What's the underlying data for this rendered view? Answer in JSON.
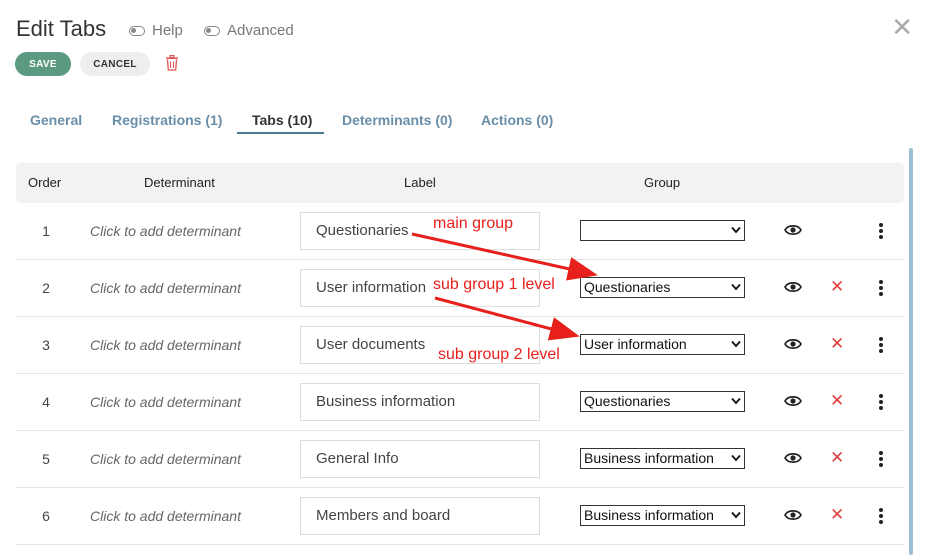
{
  "header": {
    "title": "Edit Tabs",
    "help_label": "Help",
    "advanced_label": "Advanced"
  },
  "toolbar": {
    "save_label": "SAVE",
    "cancel_label": "CANCEL"
  },
  "tabs": [
    {
      "label": "General"
    },
    {
      "label": "Registrations (1)"
    },
    {
      "label": "Tabs (10)"
    },
    {
      "label": "Determinants (0)"
    },
    {
      "label": "Actions (0)"
    }
  ],
  "active_tab": "Tabs (10)",
  "table": {
    "headers": {
      "order": "Order",
      "determinant": "Determinant",
      "label": "Label",
      "group": "Group"
    },
    "rows": [
      {
        "order": "1",
        "determinant": "Click to add determinant",
        "label": "Questionaries",
        "group": ""
      },
      {
        "order": "2",
        "determinant": "Click to add determinant",
        "label": "User information",
        "group": "Questionaries"
      },
      {
        "order": "3",
        "determinant": "Click to add determinant",
        "label": "User documents",
        "group": "User information"
      },
      {
        "order": "4",
        "determinant": "Click to add determinant",
        "label": "Business information",
        "group": "Questionaries"
      },
      {
        "order": "5",
        "determinant": "Click to add determinant",
        "label": "General Info",
        "group": "Business information"
      },
      {
        "order": "6",
        "determinant": "Click to add determinant",
        "label": "Members and board",
        "group": "Business information"
      }
    ]
  },
  "annotations": {
    "main_group": "main group",
    "sub_group_1": "sub group 1 level",
    "sub_group_2": "sub group 2 level"
  },
  "colors": {
    "save_bg": "#5b9a80",
    "tab_link": "#6a8ea8",
    "delete_red": "#e04040",
    "annotation_red": "#e8201c"
  }
}
